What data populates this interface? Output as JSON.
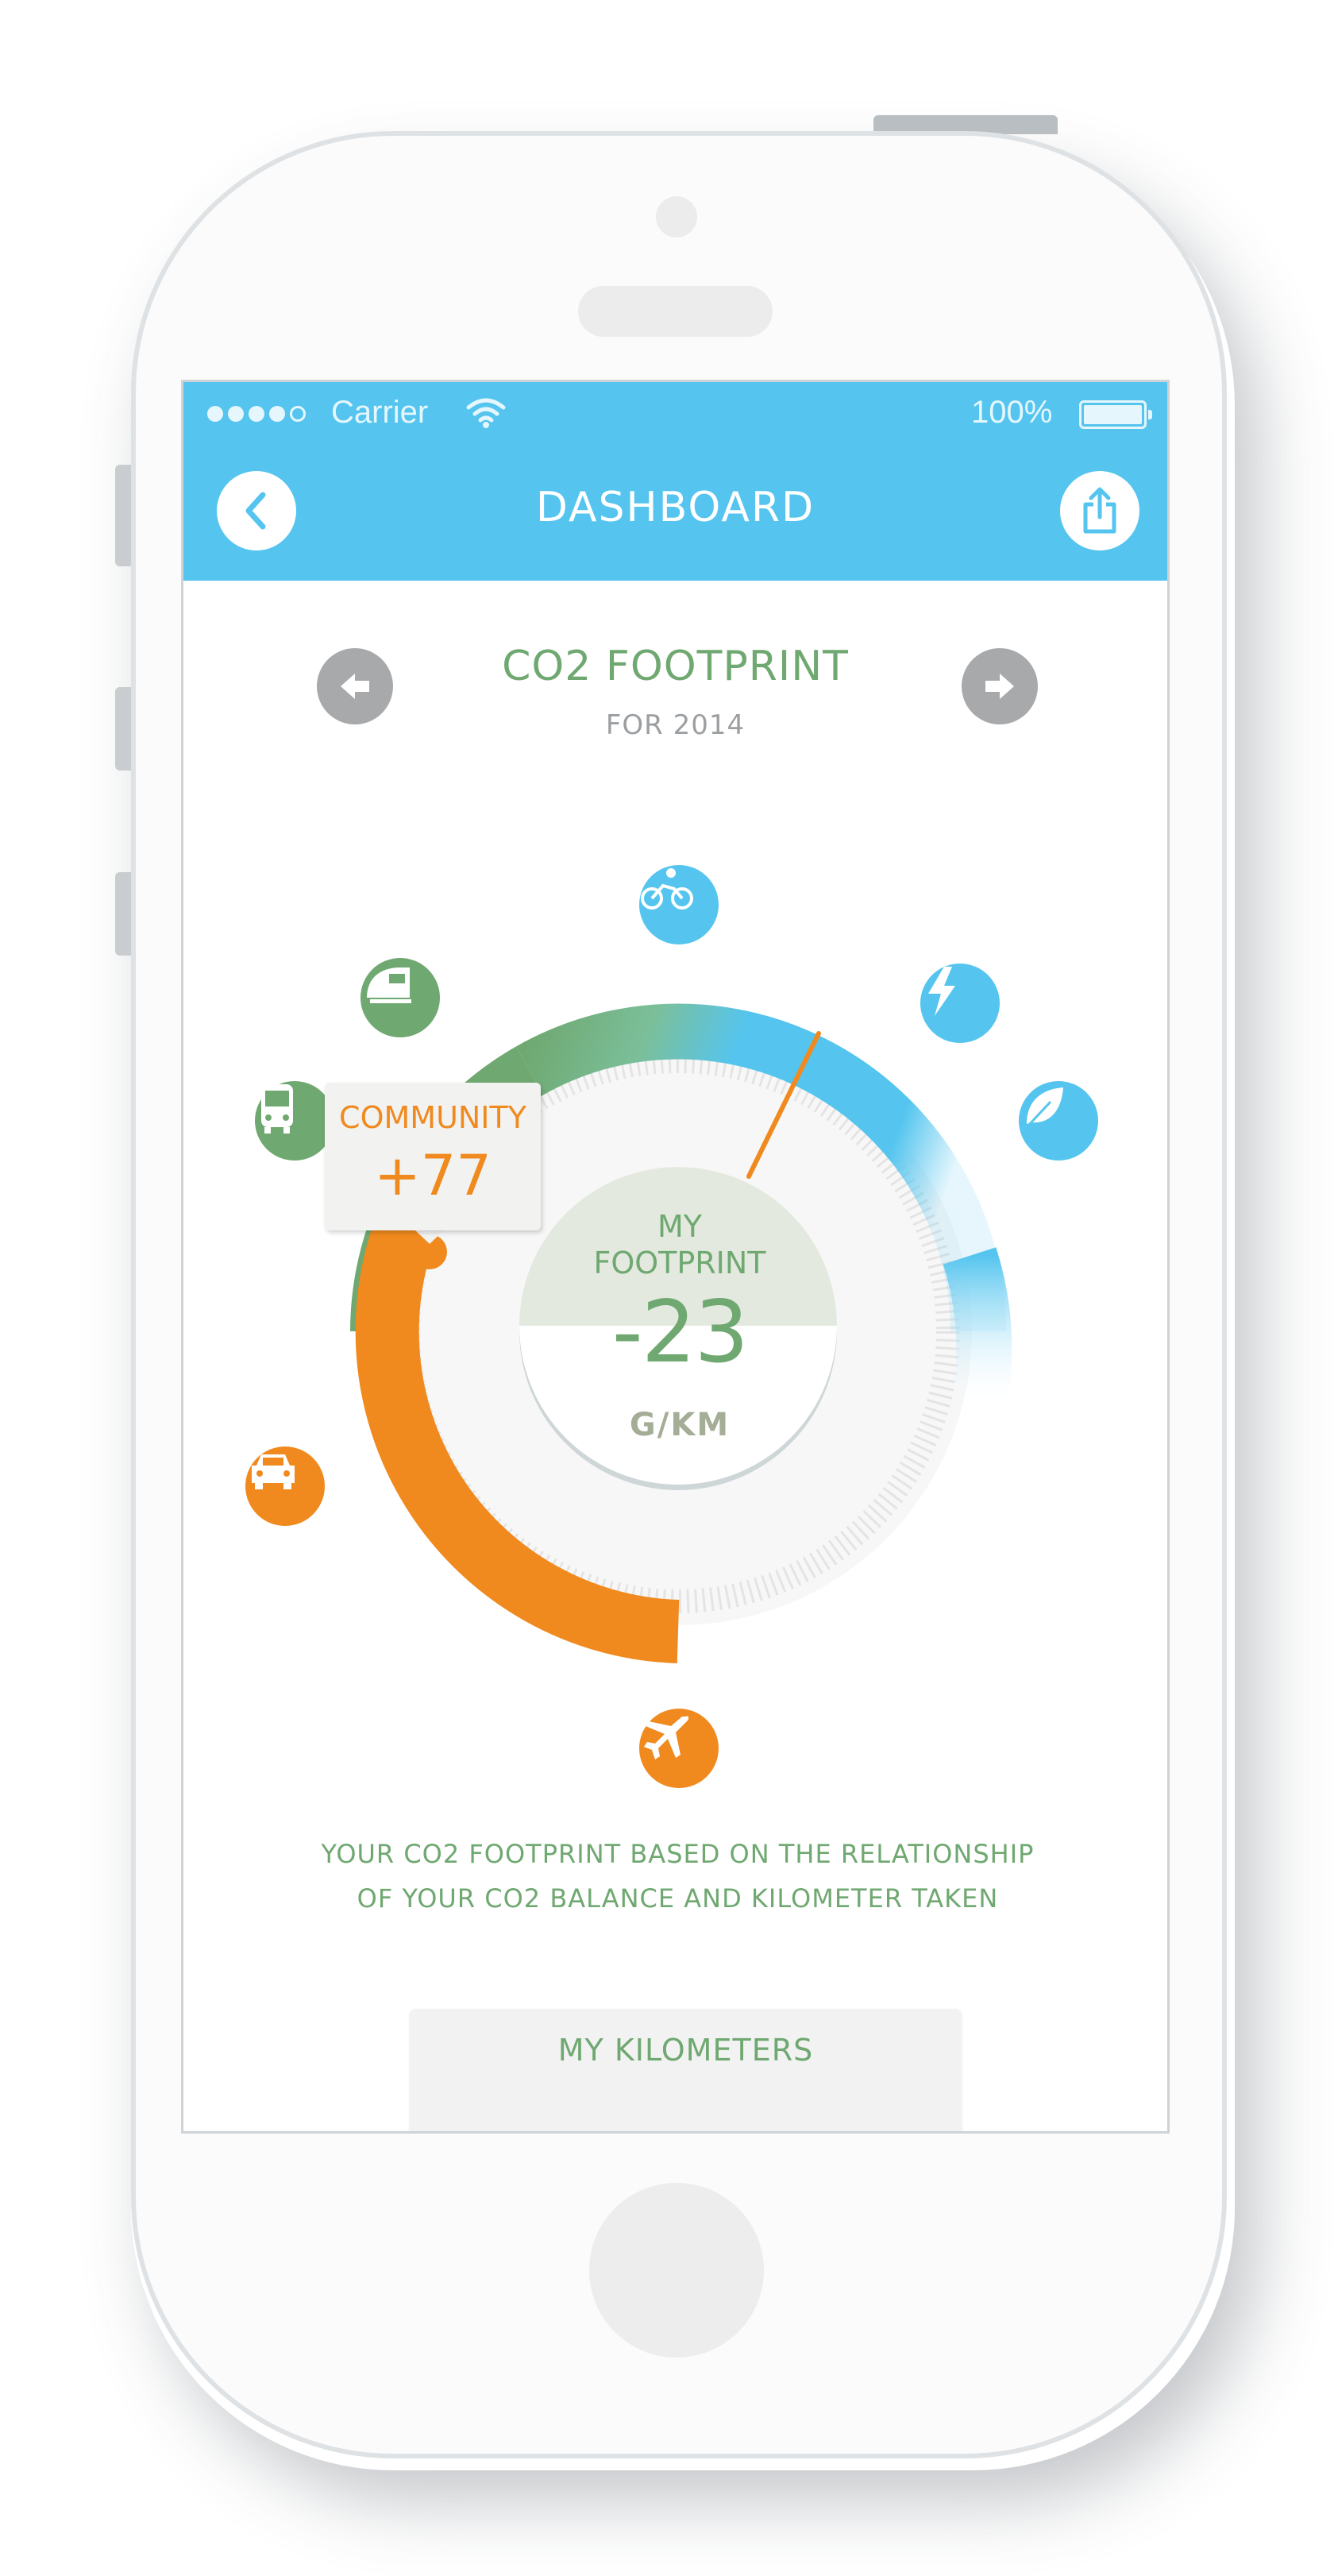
{
  "status_bar": {
    "carrier": "Carrier",
    "battery": "100%",
    "signal_icon": "signal-dots-icon",
    "wifi_icon": "wifi-icon",
    "battery_icon": "battery-icon"
  },
  "nav": {
    "title": "DASHBOARD",
    "back_icon": "chevron-left-icon",
    "share_icon": "share-icon"
  },
  "header": {
    "title": "CO2 FOOTPRINT",
    "subtitle": "FOR 2014",
    "prev_icon": "arrow-left-icon",
    "next_icon": "arrow-right-icon"
  },
  "gauge": {
    "center_label_line1": "MY",
    "center_label_line2": "FOOTPRINT",
    "value": "-23",
    "unit": "G/KM",
    "community_label": "COMMUNITY",
    "community_value": "+77",
    "categories": [
      {
        "name": "bicycle",
        "icon": "bicycle-icon",
        "color": "#55c5ef"
      },
      {
        "name": "electric",
        "icon": "lightning-icon",
        "color": "#55c5ef"
      },
      {
        "name": "eco",
        "icon": "leaf-icon",
        "color": "#55c5ef"
      },
      {
        "name": "train",
        "icon": "train-icon",
        "color": "#6fa870"
      },
      {
        "name": "bus",
        "icon": "bus-icon",
        "color": "#6fa870"
      },
      {
        "name": "car",
        "icon": "car-icon",
        "color": "#f08a1e"
      },
      {
        "name": "plane",
        "icon": "plane-icon",
        "color": "#f08a1e"
      }
    ],
    "colors": {
      "orange": "#f08a1e",
      "green": "#6fa870",
      "blue": "#55c5ef"
    }
  },
  "description": {
    "line1": "YOUR CO2 FOOTPRINT BASED ON THE RELATIONSHIP",
    "line2": "OF YOUR CO2 BALANCE AND KILOMETER TAKEN"
  },
  "tabs": {
    "kilometers": "MY KILOMETERS"
  }
}
